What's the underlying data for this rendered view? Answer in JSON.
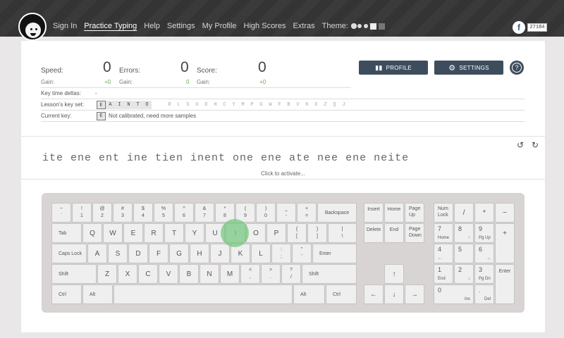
{
  "nav": {
    "items": [
      "Sign In",
      "Practice Typing",
      "Help",
      "Settings",
      "My Profile",
      "High Scores",
      "Extras"
    ],
    "active": "Practice Typing",
    "theme_label": "Theme:"
  },
  "facebook": {
    "icon": "facebook-icon",
    "count": "27184"
  },
  "stats": {
    "speed_label": "Speed:",
    "speed_value": "0",
    "errors_label": "Errors:",
    "errors_value": "0",
    "score_label": "Score:",
    "score_value": "0",
    "gain_label": "Gain:",
    "speed_gain": "+0",
    "errors_gain": "0",
    "score_gain": "+0"
  },
  "key_time_deltas": {
    "label": "Key time deltas:",
    "value": "-"
  },
  "lesson_key_set": {
    "label": "Lesson's key set:",
    "active_keys": [
      "E",
      "A",
      "I",
      "N",
      "T",
      "O"
    ],
    "inactive_keys": [
      "R",
      "L",
      "S",
      "U",
      "D",
      "H",
      "C",
      "Y",
      "M",
      "P",
      "G",
      "W",
      "F",
      "B",
      "V",
      "K",
      "X",
      "Z",
      "Q",
      "J"
    ]
  },
  "current_key": {
    "label": "Current key:",
    "key": "E",
    "message": "Not calibrated, need more samples"
  },
  "buttons": {
    "profile": "PROFILE",
    "settings": "SETTINGS",
    "help": "?"
  },
  "lesson_text": "ite ene ent ine tien inent one ene ate nee ene neite",
  "activate_hint": "Click to activate...",
  "keyboard": {
    "highlighted_key": "I",
    "row1": [
      [
        "~",
        "`"
      ],
      [
        "!",
        "1"
      ],
      [
        "@",
        "2"
      ],
      [
        "#",
        "3"
      ],
      [
        "$",
        "4"
      ],
      [
        "%",
        "5"
      ],
      [
        "^",
        "6"
      ],
      [
        "&",
        "7"
      ],
      [
        "*",
        "8"
      ],
      [
        "(",
        "9"
      ],
      [
        ")",
        "0"
      ],
      [
        "_",
        "-"
      ],
      [
        "+",
        "="
      ]
    ],
    "backspace": "Backspace",
    "tab": "Tab",
    "row2": [
      "Q",
      "W",
      "E",
      "R",
      "T",
      "Y",
      "U",
      "I",
      "O",
      "P"
    ],
    "row2_extra": [
      [
        "{",
        "["
      ],
      [
        "}",
        "]"
      ],
      [
        "|",
        "\\"
      ]
    ],
    "caps": "Caps Lock",
    "row3": [
      "A",
      "S",
      "D",
      "F",
      "G",
      "H",
      "J",
      "K",
      "L"
    ],
    "row3_extra": [
      [
        ":",
        ";"
      ],
      [
        "\"",
        "'"
      ]
    ],
    "enter": "Enter",
    "shift": "Shift",
    "row4": [
      "Z",
      "X",
      "C",
      "V",
      "B",
      "N",
      "M"
    ],
    "row4_extra": [
      [
        "<",
        ","
      ],
      [
        ">",
        "."
      ],
      [
        "?",
        "/"
      ]
    ],
    "ctrl": "Ctrl",
    "alt": "Alt",
    "nav_keys": [
      "Insert",
      "Home",
      "Page Up",
      "Delete",
      "End",
      "Page Down"
    ],
    "arrows": [
      "↑",
      "←",
      "↓",
      "→"
    ],
    "numpad": {
      "numlock": "Num Lock",
      "div": "/",
      "mul": "*",
      "minus": "−",
      "plus": "+",
      "enter": "Enter",
      "n7": [
        "7",
        "Home"
      ],
      "n8": [
        "8",
        "↑"
      ],
      "n9": [
        "9",
        "Pg Up"
      ],
      "n4": [
        "4",
        "←"
      ],
      "n5": [
        "5",
        ""
      ],
      "n6": [
        "6",
        "→"
      ],
      "n1": [
        "1",
        "End"
      ],
      "n2": [
        "2",
        "↓"
      ],
      "n3": [
        "3",
        "Pg Dn"
      ],
      "n0": [
        "0",
        "Ins"
      ],
      "dot": [
        ".",
        "Del"
      ]
    }
  }
}
